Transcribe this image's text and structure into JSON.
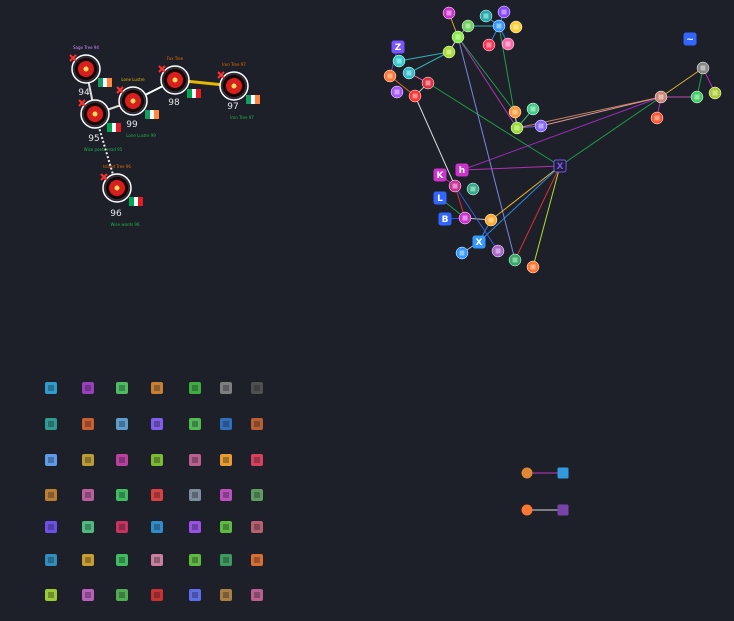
{
  "app": {
    "background": "#1d2029"
  },
  "tree": {
    "nodes": [
      {
        "id": "n94",
        "num": "94",
        "toplabel": "Sage Tree 94",
        "flag": "flag-red-icon",
        "sublabel": "",
        "red": "#d81f1f",
        "name_color": "#d58cff"
      },
      {
        "id": "n95",
        "num": "95",
        "toplabel": "",
        "flag": "flag-senegal-icon",
        "sublabel": "Wise poets read 95",
        "red": "#d81f1f",
        "name_color": "#22b14c"
      },
      {
        "id": "n99",
        "num": "99",
        "toplabel": "Lone Lustre",
        "flag": "flag-sierra-leone-icon",
        "sublabel": "Lone Lustre 99",
        "red": "#d81f1f",
        "name_color": "#e6b800"
      },
      {
        "id": "n98",
        "num": "98",
        "toplabel": "Fox Tree",
        "flag": "flag-comoros-icon",
        "sublabel": "",
        "red": "#d81f1f",
        "name_color": "#e66a00"
      },
      {
        "id": "n97",
        "num": "97",
        "toplabel": "Iron Tree 97",
        "flag": "flag-turkey-icon",
        "sublabel": "Iron Tree 97",
        "red": "#d81f1f",
        "name_color": "#e66a00"
      },
      {
        "id": "n96",
        "num": "96",
        "toplabel": "Island Tree 96",
        "flag": "flag-ireland-icon",
        "sublabel": "Wise words 96",
        "red": "#d81f1f",
        "name_color": "#e66a00"
      }
    ]
  },
  "glyph_grid": {
    "rows": [
      [
        "cube-icon",
        "atom-icon",
        "w-block-icon",
        "tiles-icon",
        "e-block-icon",
        "lines-icon",
        "chip-icon"
      ],
      [
        "globe-icon",
        "envelope-icon",
        "card-icon",
        "play-icon",
        "leaf-icon",
        "shirt-icon",
        "pie-icon"
      ],
      [
        "burger-icon",
        "ball-icon",
        "printer-icon",
        "shield-icon",
        "bus-icon",
        "stack-icon",
        "train-icon"
      ],
      [
        "door-icon",
        "tv-icon",
        "o-block-icon",
        "book-icon",
        "image-icon",
        "house-icon",
        "ring-icon"
      ],
      [
        "folder-icon",
        "magnifier-icon",
        "clock-icon",
        "gear-icon",
        "d-block-icon",
        "question-icon",
        "grid-icon"
      ],
      [
        "card-2-icon",
        "box-icon",
        "frame-icon",
        "map-icon",
        "phone-icon",
        "note-icon",
        "file-icon"
      ],
      [
        "arrow-icon",
        "chat-icon",
        "bag-icon",
        "cherry-icon",
        "wheel-icon",
        "window-icon",
        "badge-icon"
      ]
    ]
  },
  "pairs": [
    {
      "a": "cookie-icon",
      "b": "file-blue-icon"
    },
    {
      "a": "grid-orange-icon",
      "b": "folder-purple-icon"
    }
  ],
  "graph": {
    "letters": [
      "Z",
      "h",
      "K",
      "B",
      "X",
      "X",
      "L",
      "~"
    ]
  }
}
